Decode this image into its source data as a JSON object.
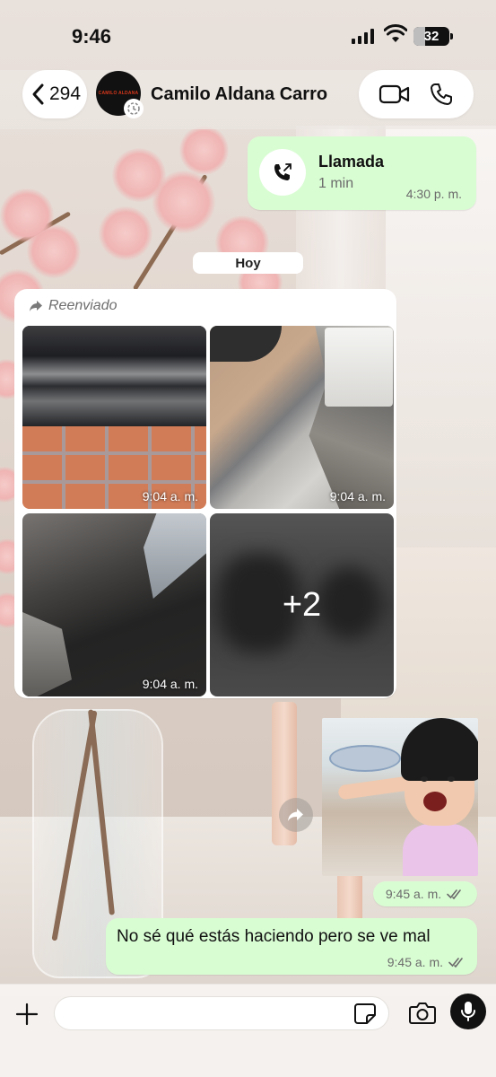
{
  "status_bar": {
    "time": "9:46",
    "battery": "32",
    "battery_level": 0.32
  },
  "header": {
    "back_count": "294",
    "avatar_text": "CAMILO ALDANA",
    "contact_name": "Camilo Aldana Carro"
  },
  "messages": {
    "call": {
      "title": "Llamada",
      "duration": "1 min",
      "time": "4:30 p. m."
    },
    "date_chip": "Hoy",
    "album": {
      "forwarded_label": "Reenviado",
      "photos": [
        {
          "time": "9:04 a. m."
        },
        {
          "time": "9:04 a. m."
        },
        {
          "time": "9:04 a. m."
        }
      ],
      "more_count": "+2"
    },
    "sticker": {
      "time": "9:45 a. m."
    },
    "text": {
      "body": "No sé qué estás haciendo pero se ve mal",
      "time": "9:45 a. m."
    }
  },
  "input": {
    "value": "",
    "placeholder": ""
  },
  "icons": {
    "back": "chevron-left-icon",
    "video": "video-camera-icon",
    "phone": "phone-icon",
    "outgoing_call": "outgoing-call-icon",
    "forwarded": "forward-arrow-icon",
    "read_ticks": "double-check-icon",
    "plus": "plus-icon",
    "sticker": "sticker-icon",
    "camera": "camera-icon",
    "mic": "microphone-icon"
  },
  "colors": {
    "outgoing_bubble": "#d9fdd3",
    "incoming_bubble": "#ffffff",
    "read_tick": "#6b6b6b"
  }
}
